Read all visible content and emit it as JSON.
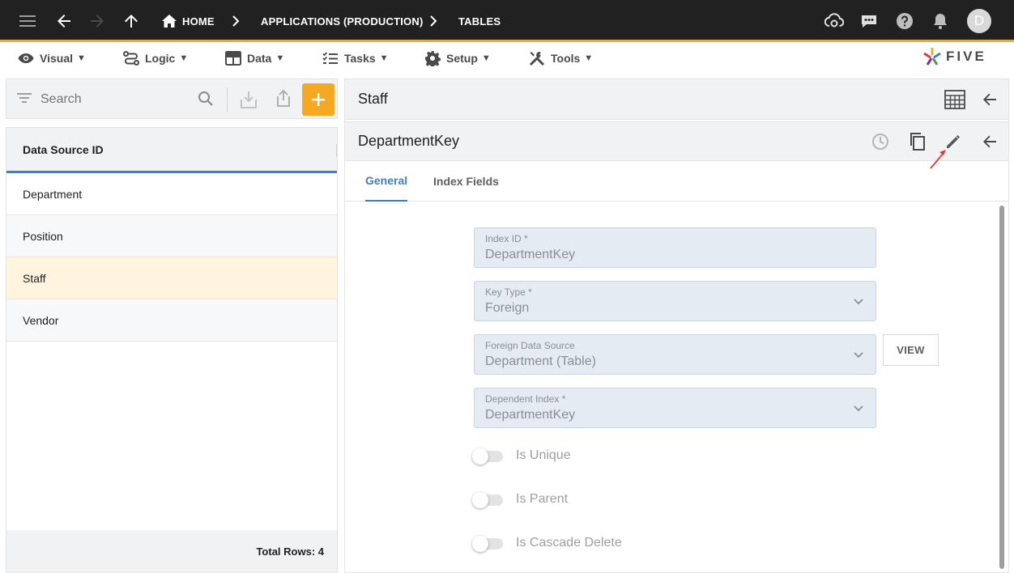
{
  "topbar": {
    "breadcrumb": [
      "HOME",
      "APPLICATIONS (PRODUCTION)",
      "TABLES"
    ],
    "avatar_initial": "D",
    "accent": "#f6a821",
    "icons": [
      "menu-icon",
      "back-arrow-icon",
      "forward-arrow-icon",
      "up-arrow-icon",
      "home-icon",
      "cloud-settings-icon",
      "chat-icon",
      "help-icon",
      "bell-icon"
    ]
  },
  "menubar": {
    "items": [
      "Visual",
      "Logic",
      "Data",
      "Tasks",
      "Setup",
      "Tools"
    ],
    "caret": "▼",
    "logo_text": "FIVE"
  },
  "left": {
    "search_placeholder": "Search",
    "column_header": "Data Source ID",
    "rows": [
      "Department",
      "Position",
      "Staff",
      "Vendor"
    ],
    "selected_row": "Staff",
    "footer": "Total Rows: 4"
  },
  "right": {
    "panel_title": "Staff",
    "record_title": "DepartmentKey",
    "tabs": [
      "General",
      "Index Fields"
    ],
    "active_tab": "General",
    "fields": {
      "index_id": {
        "label": "Index ID *",
        "value": "DepartmentKey"
      },
      "key_type": {
        "label": "Key Type *",
        "value": "Foreign"
      },
      "foreign_source": {
        "label": "Foreign Data Source",
        "value": "Department (Table)"
      },
      "dependent_index": {
        "label": "Dependent Index *",
        "value": "DepartmentKey"
      }
    },
    "view_button": "VIEW",
    "toggles": [
      {
        "label": "Is Unique",
        "on": false
      },
      {
        "label": "Is Parent",
        "on": false
      },
      {
        "label": "Is Cascade Delete",
        "on": false
      }
    ]
  },
  "colors": {
    "primary": "#3d7fc6",
    "accent": "#f6a821",
    "selected_row": "#fff4de"
  }
}
